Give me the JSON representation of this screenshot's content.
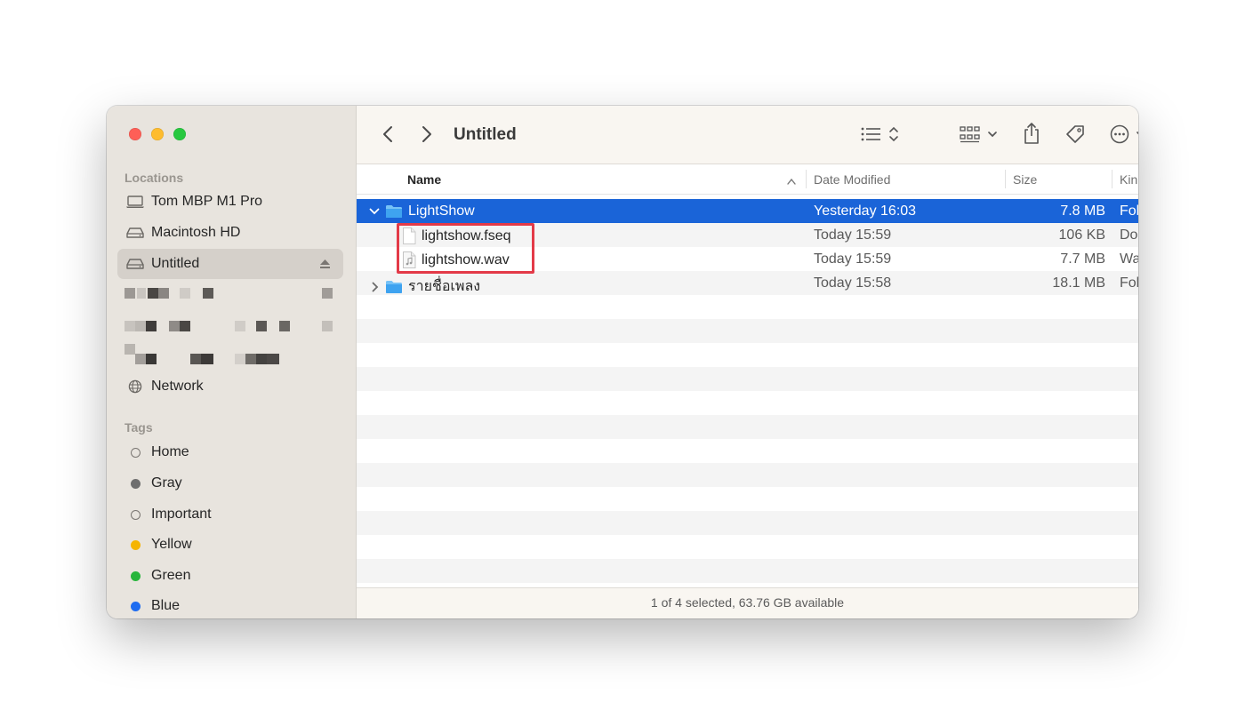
{
  "window": {
    "title": "Untitled"
  },
  "sidebar": {
    "locations_header": "Locations",
    "locations": [
      {
        "label": "Tom MBP M1 Pro",
        "icon": "laptop-icon"
      },
      {
        "label": "Macintosh HD",
        "icon": "drive-icon"
      },
      {
        "label": "Untitled",
        "icon": "drive-icon",
        "selected": true,
        "eject": true
      },
      {
        "label": "Network",
        "icon": "network-icon"
      }
    ],
    "tags_header": "Tags",
    "tags": [
      {
        "label": "Home",
        "color": ""
      },
      {
        "label": "Gray",
        "color": "#6e6e6e"
      },
      {
        "label": "Important",
        "color": ""
      },
      {
        "label": "Yellow",
        "color": "#f5b400"
      },
      {
        "label": "Green",
        "color": "#28b53c"
      },
      {
        "label": "Blue",
        "color": "#1e6cf0"
      }
    ]
  },
  "toolbar": {
    "back_icon": "chevron-left-icon",
    "forward_icon": "chevron-right-icon",
    "view_icon": "list-view-icon",
    "group_icon": "grid-group-icon",
    "share_icon": "share-icon",
    "tag_icon": "tag-icon",
    "more_icon": "ellipsis-circle-icon",
    "search_icon": "search-icon"
  },
  "columns": {
    "name": "Name",
    "date": "Date Modified",
    "size": "Size",
    "kind": "Kin"
  },
  "files": [
    {
      "name": "LightShow",
      "date": "Yesterday 16:03",
      "size": "7.8 MB",
      "kind": "Fol",
      "type": "folder",
      "expanded": true,
      "selected": true,
      "level": 0
    },
    {
      "name": "lightshow.fseq",
      "date": "Today 15:59",
      "size": "106 KB",
      "kind": "Do",
      "type": "document",
      "level": 1
    },
    {
      "name": "lightshow.wav",
      "date": "Today 15:59",
      "size": "7.7 MB",
      "kind": "Wa",
      "type": "audio",
      "level": 1
    },
    {
      "name": "รายชื่อเพลง",
      "date": "Today 15:58",
      "size": "18.1 MB",
      "kind": "Fol",
      "type": "folder",
      "expanded": false,
      "level": 0
    }
  ],
  "status": {
    "text": "1 of 4 selected, 63.76 GB available"
  },
  "colors": {
    "selection": "#1a64d8",
    "highlight_box": "#e33a48",
    "folder": "#3ea3f0"
  }
}
